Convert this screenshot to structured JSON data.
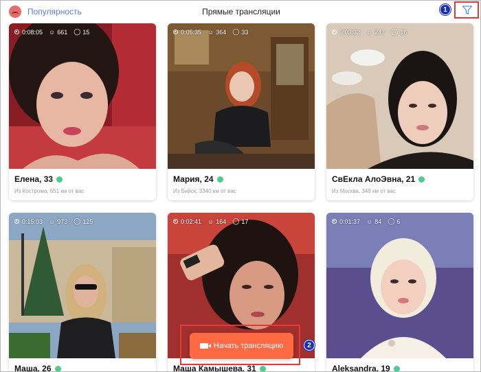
{
  "header": {
    "sort_label": "Популярность",
    "title": "Прямые трансляции",
    "filter_icon": "filter-icon",
    "badge_1": "1",
    "badge_2": "2"
  },
  "streams": [
    {
      "duration": "0:08:05",
      "viewers": "661",
      "comments": "15",
      "name": "Елена, 33",
      "distance": "Из Кострома, 651 км от вас"
    },
    {
      "duration": "0:05:35",
      "viewers": "364",
      "comments": "33",
      "name": "Мария, 24",
      "distance": "Из Бийск, 3340 км от вас"
    },
    {
      "duration": "0:03:32",
      "viewers": "247",
      "comments": "16",
      "name": "СвЕкла АлоЭвна, 21",
      "distance": "Из Москва, 349 км от вас"
    },
    {
      "duration": "0:15:03",
      "viewers": "973",
      "comments": "125",
      "name": "Маша, 26",
      "distance": ""
    },
    {
      "duration": "0:02:41",
      "viewers": "164",
      "comments": "17",
      "name": "Маша Камышева, 31",
      "distance": ""
    },
    {
      "duration": "0:01:37",
      "viewers": "84",
      "comments": "6",
      "name": "Aleksandra, 19",
      "distance": ""
    }
  ],
  "start_button": {
    "label": "Начать трансляцию",
    "icon": "camera-icon"
  },
  "colors": {
    "accent": "#ff6a45",
    "online": "#4ecb8e",
    "highlight": "#e53935",
    "badge": "#1a2fb8",
    "link": "#5b7bd6"
  }
}
